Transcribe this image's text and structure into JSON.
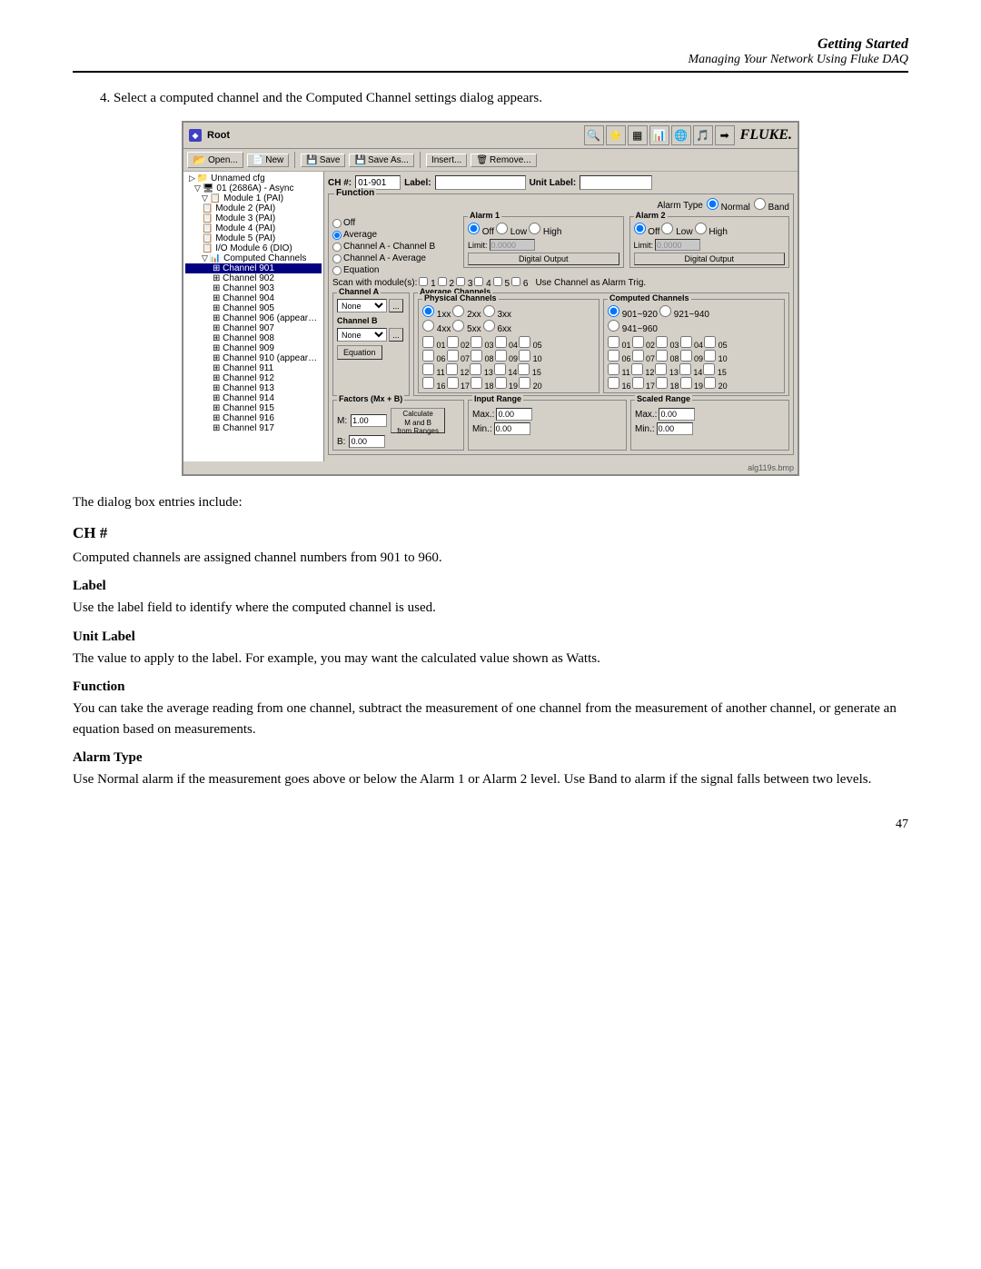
{
  "header": {
    "title": "Getting Started",
    "subtitle": "Managing Your Network Using Fluke DAQ"
  },
  "step": {
    "number": "4.",
    "text": "Select a computed channel and the Computed Channel settings dialog appears."
  },
  "dialog": {
    "titlebar": {
      "icon": "◆",
      "text": "Root"
    },
    "fluke_logo": "FLUKE.",
    "toolbar": {
      "open_label": "Open...",
      "new_label": "New",
      "save_label": "Save",
      "save_as_label": "Save As...",
      "insert_label": "Insert...",
      "remove_label": "Remove..."
    },
    "ch_row": {
      "ch_label": "CH #:",
      "ch_value": "01-901",
      "label_label": "Label:",
      "label_value": "",
      "unit_label": "Unit Label:",
      "unit_value": ""
    },
    "function_section": {
      "title": "Function",
      "alarm_type_label": "Alarm Type",
      "alarm_normal": "Normal",
      "alarm_band": "Band",
      "off_label": "Off",
      "average_label": "Average",
      "channel_a_b_label": "Channel A - Channel B",
      "channel_a_avg_label": "Channel A - Average",
      "equation_label": "Equation"
    },
    "alarm1": {
      "title": "Alarm 1",
      "off": "Off",
      "low": "Low",
      "high": "High",
      "limit_value": "0.0000"
    },
    "alarm2": {
      "title": "Alarm 2",
      "off": "Off",
      "low": "Low",
      "high": "High",
      "limit_value": "0.0000"
    },
    "digital_output": "Digital Output",
    "scan_row": {
      "label": "Scan with module(s):",
      "modules": [
        "1",
        "2",
        "3",
        "4",
        "5",
        "6"
      ],
      "use_alarm_label": "Use Channel as Alarm Trig."
    },
    "channel_a": {
      "title": "Channel A",
      "select_value": "None"
    },
    "channel_b": {
      "title": "Channel B",
      "select_value": "None"
    },
    "average_channels": {
      "title": "Average Channels"
    },
    "physical_channels": {
      "title": "Physical Channels",
      "options": [
        "1xx",
        "2xx",
        "3xx",
        "4xx",
        "5xx",
        "6xx"
      ],
      "selected": "1xx",
      "rows": [
        [
          "01",
          "02",
          "03",
          "04",
          "05"
        ],
        [
          "06",
          "07",
          "08",
          "09",
          "10"
        ],
        [
          "11",
          "12",
          "13",
          "14",
          "15"
        ],
        [
          "16",
          "17",
          "18",
          "19",
          "20"
        ]
      ]
    },
    "computed_channels": {
      "title": "Computed Channels",
      "options": [
        "901~920",
        "921~940",
        "941~960"
      ],
      "selected": "901~920",
      "rows": [
        [
          "01",
          "02",
          "03",
          "04",
          "05"
        ],
        [
          "06",
          "07",
          "08",
          "09",
          "10"
        ],
        [
          "11",
          "12",
          "13",
          "14",
          "15"
        ],
        [
          "16",
          "17",
          "18",
          "19",
          "20"
        ]
      ]
    },
    "equation_btn": "Equation",
    "factors": {
      "title": "Factors (Mx + B)",
      "m_label": "M:",
      "m_value": "1.00",
      "b_label": "B:",
      "b_value": "0.00",
      "calc_btn": "Calculate\nM and B\nfrom Ranges"
    },
    "input_range": {
      "title": "Input Range",
      "max_label": "Max.:",
      "max_value": "0.00",
      "min_label": "Min.:",
      "min_value": "0.00"
    },
    "scaled_range": {
      "title": "Scaled Range",
      "max_label": "Max.:",
      "max_value": "0.00",
      "min_label": "Min.:",
      "min_value": "0.00"
    },
    "caption": "alg119s.bmp"
  },
  "body": {
    "intro": "The dialog box entries include:",
    "ch_heading": "CH #",
    "ch_desc": "Computed channels are assigned channel numbers from 901 to 960.",
    "label_heading": "Label",
    "label_desc": "Use the label field to identify where the computed channel is used.",
    "unit_label_heading": "Unit Label",
    "unit_label_desc": "The value to apply to the label. For example, you may want the calculated value shown as Watts.",
    "function_heading": "Function",
    "function_desc": "You can take the average reading from one channel, subtract the measurement of one channel from the measurement of another channel, or generate an equation based on measurements.",
    "alarm_type_heading": "Alarm Type",
    "alarm_type_desc": "Use Normal alarm if the measurement goes above or below the Alarm 1 or Alarm 2 level. Use Band to alarm if the signal falls between two levels."
  },
  "page_number": "47"
}
